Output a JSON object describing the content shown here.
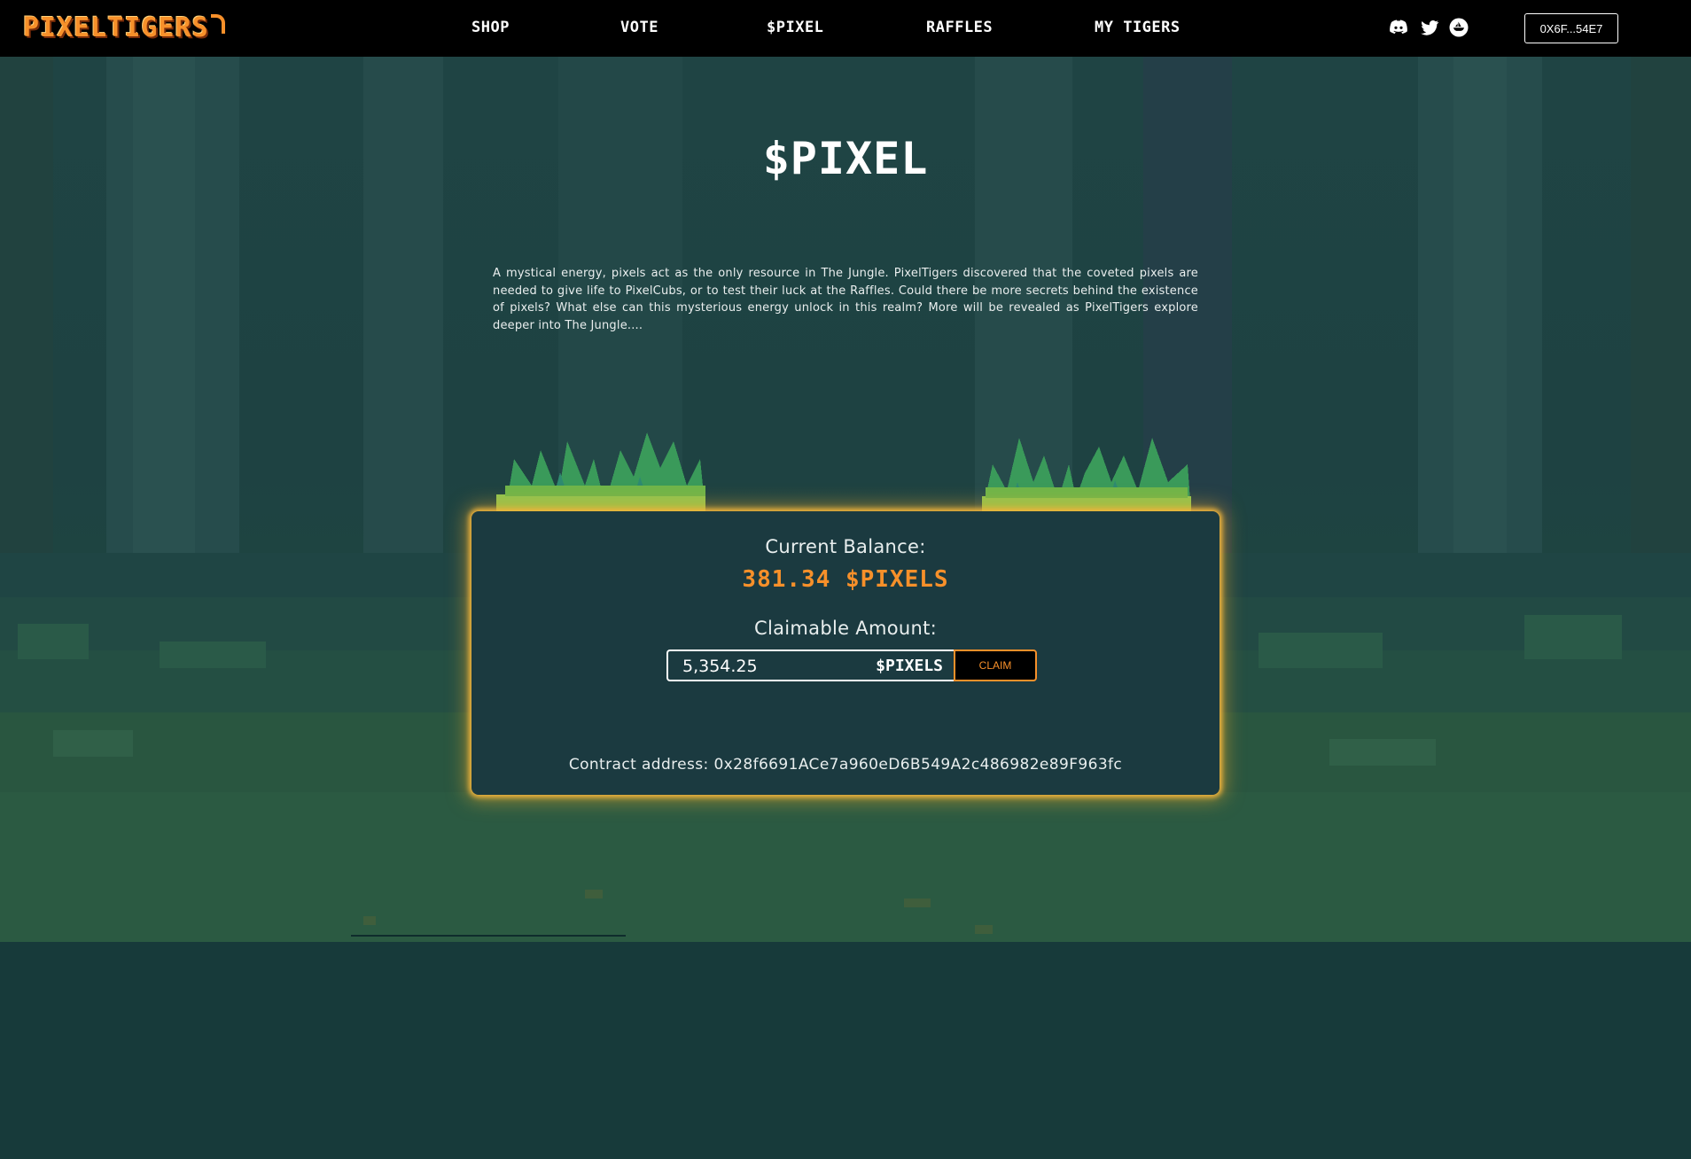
{
  "header": {
    "logo": "PIXELTIGERS",
    "nav": [
      "SHOP",
      "VOTE",
      "$PIXEL",
      "RAFFLES",
      "MY TIGERS"
    ],
    "socials": [
      "discord-icon",
      "twitter-icon",
      "opensea-icon"
    ],
    "wallet_label": "0X6F...54E7"
  },
  "main": {
    "title": "$PIXEL",
    "description": "A mystical energy, pixels act as the only resource in The Jungle. PixelTigers discovered that the coveted pixels are needed to give life to PixelCubs, or to test their luck at the Raffles. Could there be more secrets behind the existence of pixels? What else can this mysterious energy unlock in this realm? More will be revealed as PixelTigers explore deeper into The Jungle...."
  },
  "panel": {
    "balance_label": "Current Balance:",
    "balance_value": "381.34 $PIXELS",
    "claim_label": "Claimable Amount:",
    "claim_value": "5,354.25",
    "claim_unit": "$PIXELS",
    "claim_button": "CLAIM",
    "contract_text": "Contract address: 0x28f6691ACe7a960eD6B549A2c486982e89F963fc"
  },
  "colors": {
    "accent": "#f7902a",
    "header_bg": "#000000",
    "page_bg": "#173a3a",
    "panel_bg": "#1b3a40",
    "panel_glow": "#f0b43c"
  }
}
